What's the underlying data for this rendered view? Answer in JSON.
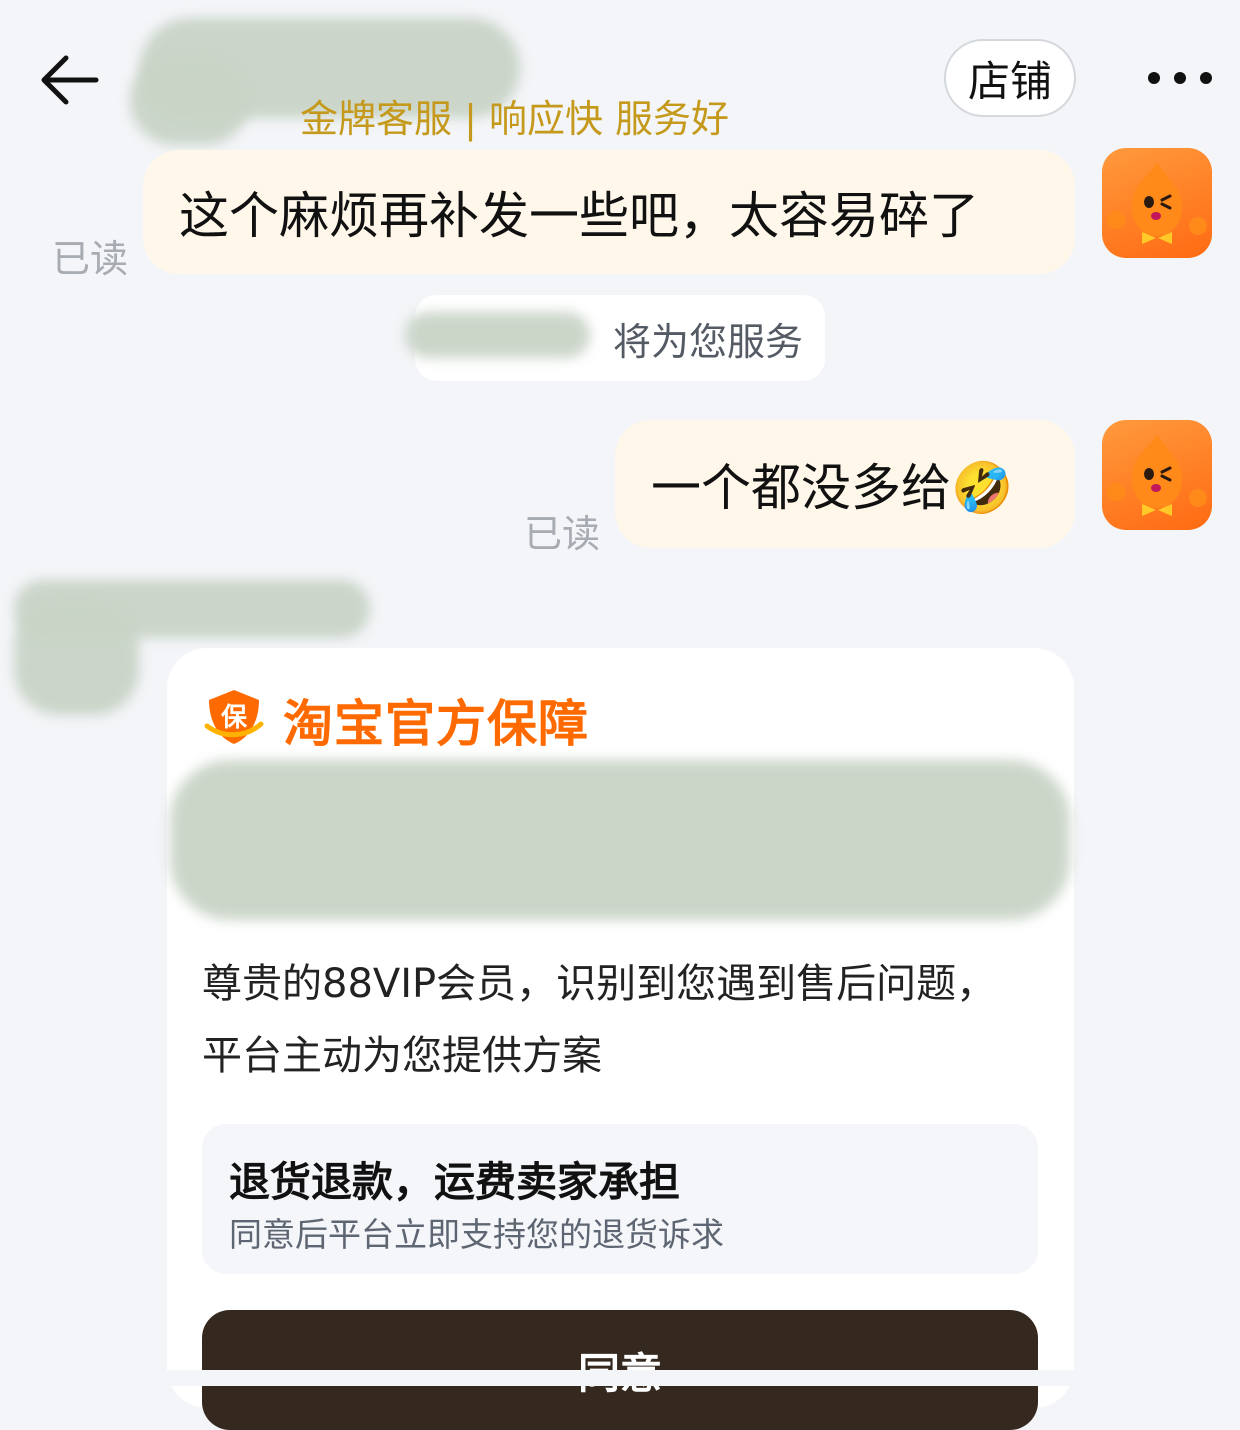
{
  "header": {
    "subtitle": "金牌客服 | 响应快 服务好",
    "shop_label": "店铺",
    "back_icon": "arrow-left-icon",
    "more_icon": "more-dots-icon"
  },
  "messages": [
    {
      "text": "这个麻烦再补发一些吧，太容易碎了",
      "status": "已读"
    },
    {
      "text": "一个都没多给🤣",
      "status": "已读"
    }
  ],
  "system_notice": "将为您服务",
  "card": {
    "brand": "淘宝官方保障",
    "badge_char": "保",
    "message": "尊贵的88VIP会员，识别到您遇到售后问题，平台主动为您提供方案",
    "option_title": "退货退款，运费卖家承担",
    "option_desc": "同意后平台立即支持您的退货诉求",
    "agree_label": "同意"
  },
  "colors": {
    "accent_orange": "#ff6a00",
    "gold": "#c59a1c",
    "bubble_bg": "#fff8ea",
    "page_bg": "#f3f5f8",
    "button_dark": "#35281f"
  }
}
